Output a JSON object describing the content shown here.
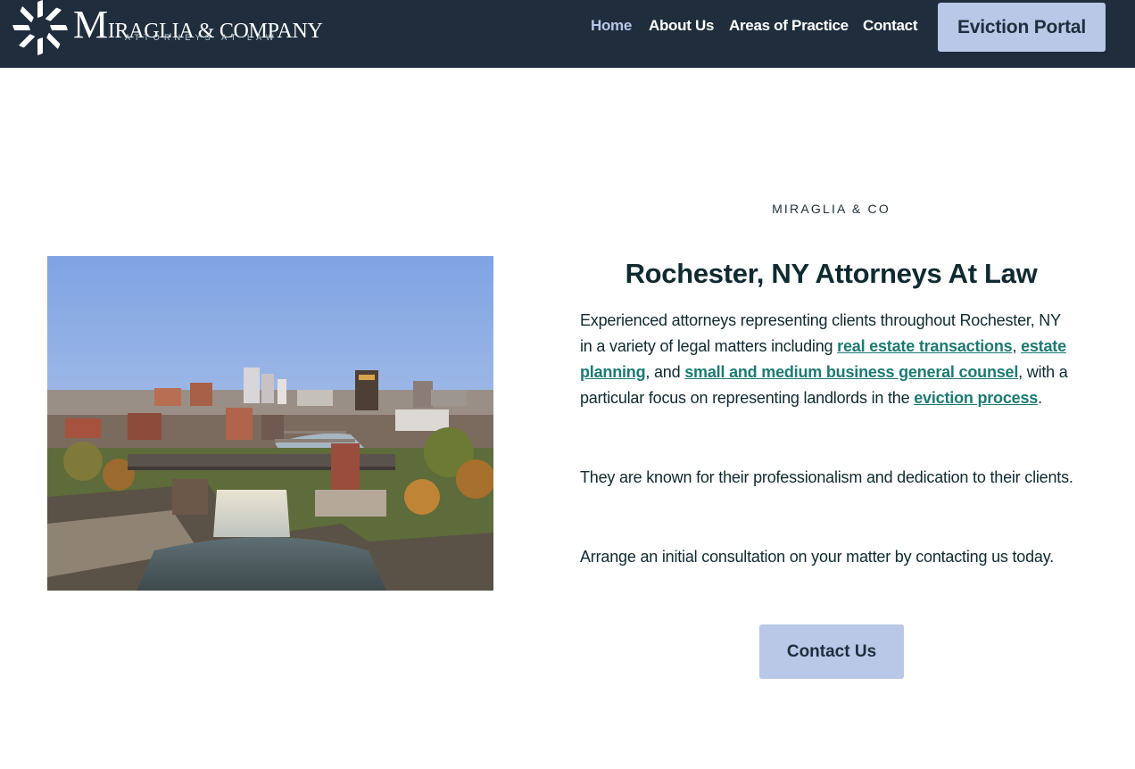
{
  "brand": {
    "initial": "M",
    "name_rest": "IRAGLIA & COMPANY",
    "tagline": "ATTORNEYS AT LAW"
  },
  "nav": {
    "items": [
      {
        "label": "Home",
        "active": true
      },
      {
        "label": "About Us",
        "active": false
      },
      {
        "label": "Areas of Practice",
        "active": false
      },
      {
        "label": "Contact",
        "active": false
      }
    ],
    "portal_label": "Eviction Portal"
  },
  "hero": {
    "image_alt": "Aerial view of Rochester, NY skyline and High Falls"
  },
  "content": {
    "eyebrow": "MIRAGLIA & CO",
    "headline": "Rochester, NY Attorneys At Law",
    "p1": {
      "t1": "Experienced attorneys representing clients throughout Rochester, NY in a variety of legal matters including ",
      "link1": "real estate transactions",
      "t2": ", ",
      "link2": "estate planning",
      "t3": ", and ",
      "link3": "small and medium business general counsel",
      "t4": ", with a particular focus on representing landlords in the ",
      "link4": "eviction process",
      "t5": "."
    },
    "p2": "They are known for their professionalism and dedication to their clients.",
    "p3": "Arrange an initial consultation on your matter by contacting us today.",
    "cta_label": "Contact Us"
  },
  "colors": {
    "header_bg": "#1f2d3d",
    "button_bg": "#b8c8e6",
    "link": "#1d7a72",
    "text": "#0f2a30"
  }
}
